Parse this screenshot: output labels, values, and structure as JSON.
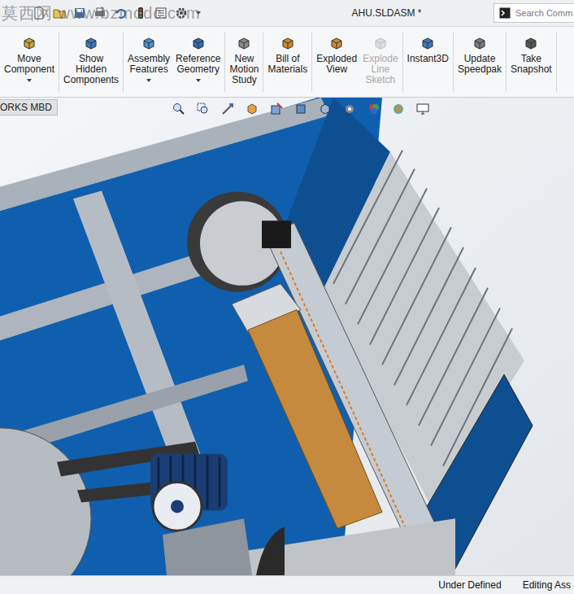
{
  "watermark": "莫西网 www.bzmodc.com",
  "window": {
    "title": "AHU.SLDASM *"
  },
  "search": {
    "placeholder": "Search Comm"
  },
  "ribbon": [
    [
      {
        "label": "Move Component",
        "dropdown": true,
        "disabled": false
      }
    ],
    [
      {
        "label": "Show Hidden Components",
        "dropdown": false,
        "disabled": false
      }
    ],
    [
      {
        "label": "Assembly Features",
        "dropdown": true,
        "disabled": false
      },
      {
        "label": "Reference Geometry",
        "dropdown": true,
        "disabled": false
      }
    ],
    [
      {
        "label": "New Motion Study",
        "dropdown": false,
        "disabled": false
      }
    ],
    [
      {
        "label": "Bill of Materials",
        "dropdown": false,
        "disabled": false
      }
    ],
    [
      {
        "label": "Exploded View",
        "dropdown": false,
        "disabled": false
      },
      {
        "label": "Explode Line Sketch",
        "dropdown": false,
        "disabled": true
      }
    ],
    [
      {
        "label": "Instant3D",
        "dropdown": false,
        "disabled": false
      }
    ],
    [
      {
        "label": "Update Speedpak",
        "dropdown": false,
        "disabled": false
      }
    ],
    [
      {
        "label": "Take Snapshot",
        "dropdown": false,
        "disabled": false
      }
    ]
  ],
  "tabs": [
    {
      "label": "ORKS MBD",
      "selected": false
    }
  ],
  "status_bar": [
    "Under Defined",
    "Editing Ass"
  ]
}
